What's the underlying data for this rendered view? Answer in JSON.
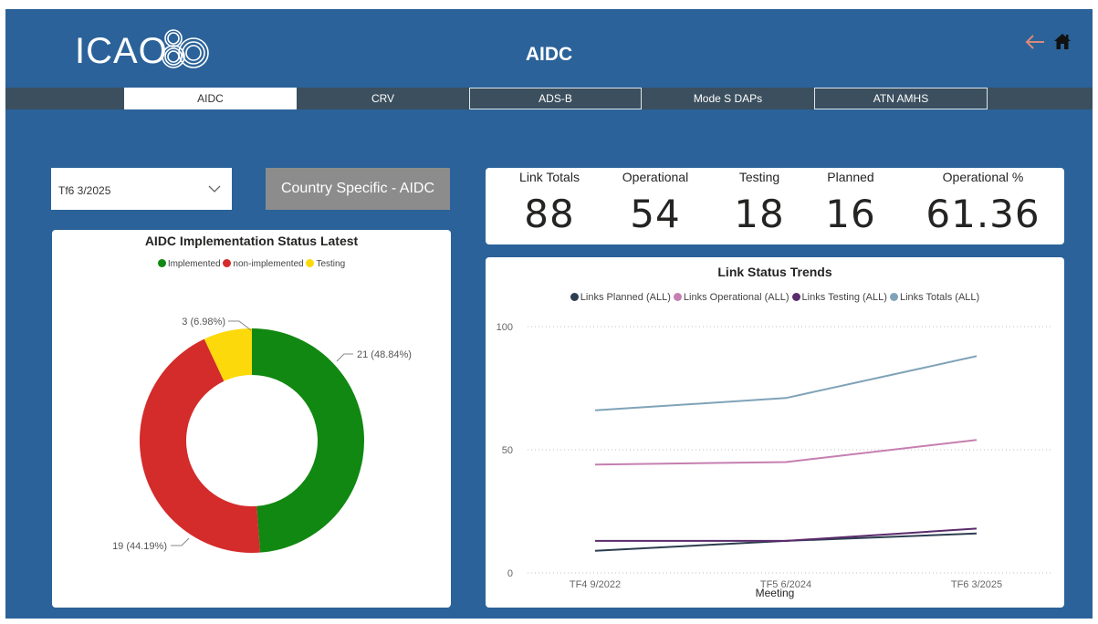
{
  "header": {
    "logo_text": "ICAO",
    "title": "AIDC",
    "back_icon": "back-arrow-icon",
    "home_icon": "home-icon"
  },
  "nav": {
    "tabs": [
      {
        "label": "AIDC",
        "active": true
      },
      {
        "label": "CRV",
        "active": false
      },
      {
        "label": "ADS-B",
        "active": false
      },
      {
        "label": "Mode S DAPs",
        "active": false
      },
      {
        "label": "ATN AMHS",
        "active": false
      }
    ]
  },
  "filter": {
    "selected": "Tf6 3/2025",
    "icon": "chevron-down-icon"
  },
  "country_button": "Country Specific - AIDC",
  "kpis": [
    {
      "label": "Link Totals",
      "value": "88"
    },
    {
      "label": "Operational",
      "value": "54"
    },
    {
      "label": "Testing",
      "value": "18"
    },
    {
      "label": "Planned",
      "value": "16"
    },
    {
      "label": "Operational %",
      "value": "61.36"
    }
  ],
  "colors": {
    "background": "#2b6299",
    "navbar": "#3b4f5e",
    "implemented": "#118811",
    "non_implemented": "#d42b2b",
    "testing": "#fcd90a",
    "planned_line": "#2d3e50",
    "operational_line": "#c57fb0",
    "testing_line": "#5b2b6b",
    "totals_line": "#7fa3b8"
  },
  "chart_data": [
    {
      "type": "pie",
      "title": "AIDC Implementation Status Latest",
      "legend_position": "top",
      "categories": [
        "Implemented",
        "non-implemented",
        "Testing"
      ],
      "values": [
        21,
        19,
        3
      ],
      "labels": [
        "21 (48.84%)",
        "19 (44.19%)",
        "3 (6.98%)"
      ],
      "colors": [
        "#118811",
        "#d42b2b",
        "#fcd90a"
      ]
    },
    {
      "type": "line",
      "title": "Link Status Trends",
      "xlabel": "Meeting",
      "ylabel": "",
      "legend_position": "top",
      "x": [
        "TF4 9/2022",
        "TF5 6/2024",
        "TF6 3/2025"
      ],
      "ylim": [
        0,
        100
      ],
      "yticks": [
        "0",
        "50",
        "100"
      ],
      "grid": true,
      "series": [
        {
          "name": "Links Planned (ALL)",
          "values": [
            9,
            13,
            16
          ],
          "color": "#2d3e50"
        },
        {
          "name": "Links Operational (ALL)",
          "values": [
            44,
            45,
            54
          ],
          "color": "#c57fb0"
        },
        {
          "name": "Links Testing (ALL)",
          "values": [
            13,
            13,
            18
          ],
          "color": "#5b2b6b"
        },
        {
          "name": "Links Totals (ALL)",
          "values": [
            66,
            71,
            88
          ],
          "color": "#7fa3b8"
        }
      ]
    }
  ]
}
